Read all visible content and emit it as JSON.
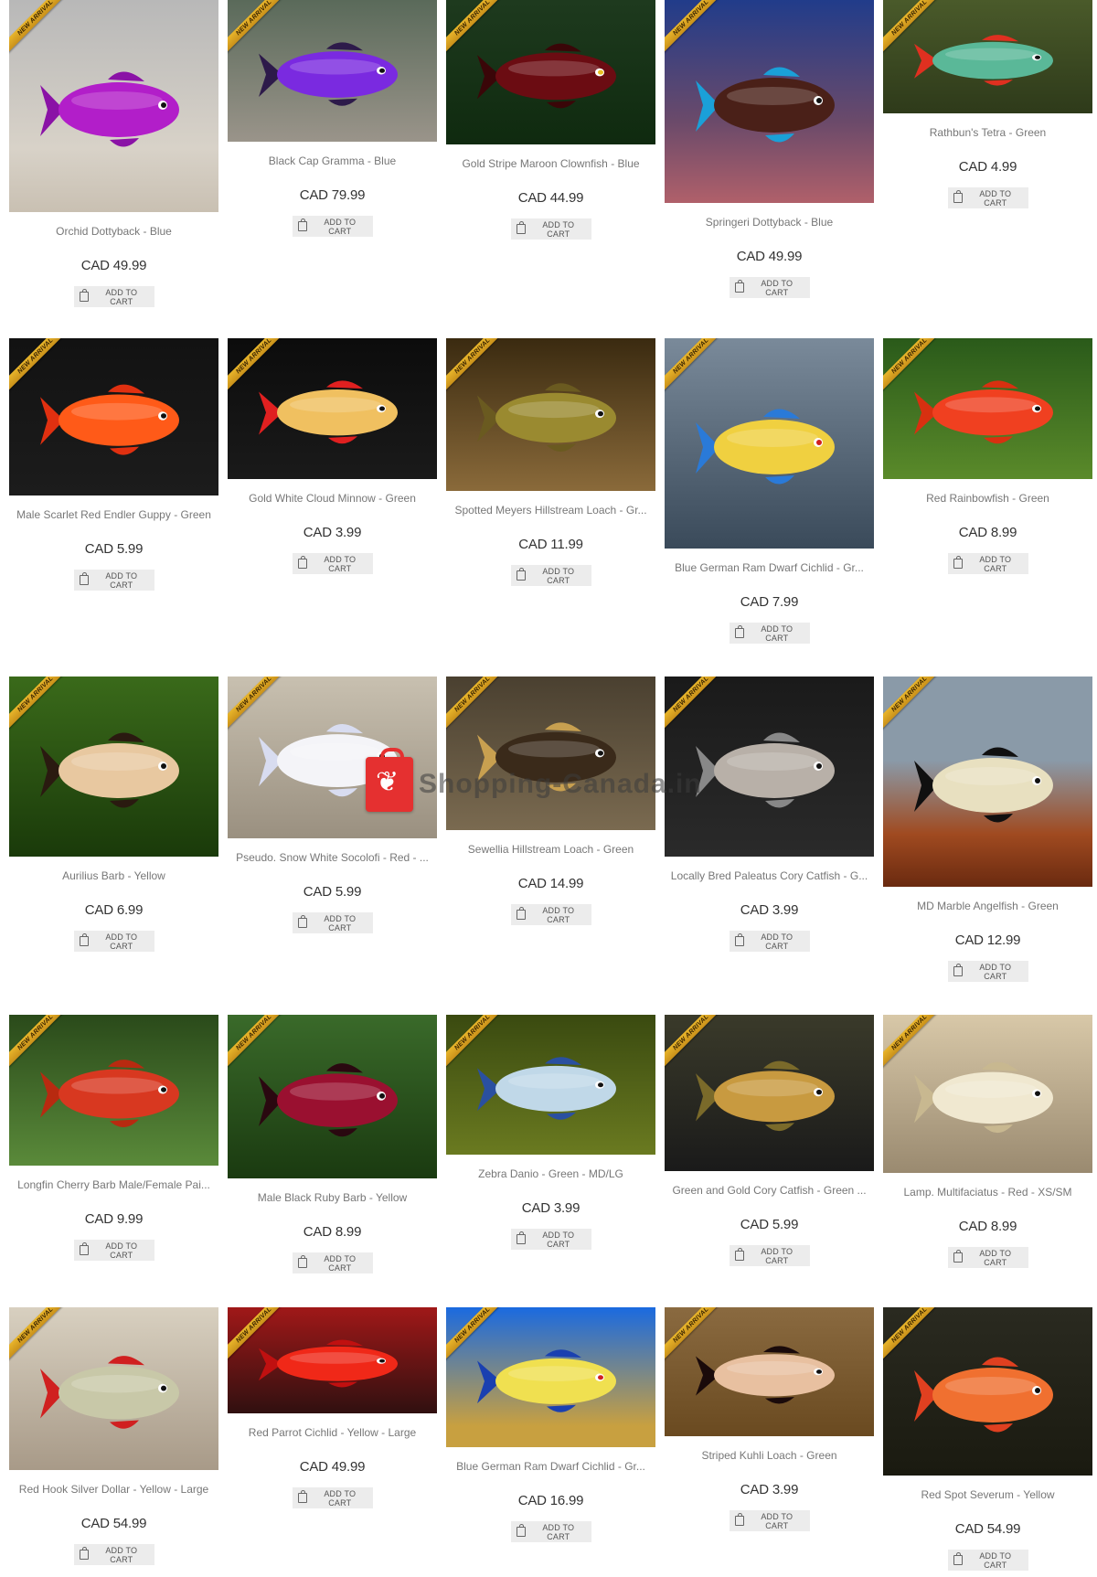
{
  "badge_text": "NEW ARRIVAL",
  "cart_label": "ADD TO CART",
  "watermark": "Shopping-Canada.in",
  "products": [
    {
      "title": "Orchid Dottyback - Blue",
      "price": "CAD 49.99"
    },
    {
      "title": "Black Cap Gramma - Blue",
      "price": "CAD 79.99"
    },
    {
      "title": "Gold Stripe Maroon Clownfish - Blue",
      "price": "CAD 44.99"
    },
    {
      "title": "Springeri Dottyback - Blue",
      "price": "CAD 49.99"
    },
    {
      "title": "Rathbun's Tetra - Green",
      "price": "CAD 4.99"
    },
    {
      "title": "Male Scarlet Red Endler Guppy - Green",
      "price": "CAD 5.99"
    },
    {
      "title": "Gold White Cloud Minnow - Green",
      "price": "CAD 3.99"
    },
    {
      "title": "Spotted Meyers Hillstream Loach - Gr...",
      "price": "CAD 11.99"
    },
    {
      "title": "Blue German Ram Dwarf Cichlid - Gr...",
      "price": "CAD 7.99"
    },
    {
      "title": "Red Rainbowfish - Green",
      "price": "CAD 8.99"
    },
    {
      "title": "Aurilius Barb - Yellow",
      "price": "CAD 6.99"
    },
    {
      "title": "Pseudo. Snow White Socolofi - Red - ...",
      "price": "CAD 5.99"
    },
    {
      "title": "Sewellia Hillstream Loach - Green",
      "price": "CAD 14.99"
    },
    {
      "title": "Locally Bred Paleatus Cory Catfish - G...",
      "price": "CAD 3.99"
    },
    {
      "title": "MD Marble Angelfish - Green",
      "price": "CAD 12.99"
    },
    {
      "title": "Longfin Cherry Barb Male/Female Pai...",
      "price": "CAD 9.99"
    },
    {
      "title": "Male Black Ruby Barb - Yellow",
      "price": "CAD 8.99"
    },
    {
      "title": "Zebra Danio - Green - MD/LG",
      "price": "CAD 3.99"
    },
    {
      "title": "Green and Gold Cory Catfish - Green ...",
      "price": "CAD 5.99"
    },
    {
      "title": "Lamp. Multifaciatus - Red - XS/SM",
      "price": "CAD 8.99"
    },
    {
      "title": "Red Hook Silver Dollar - Yellow - Large",
      "price": "CAD 54.99"
    },
    {
      "title": "Red Parrot Cichlid - Yellow - Large",
      "price": "CAD 49.99"
    },
    {
      "title": "Blue German Ram Dwarf Cichlid - Gr...",
      "price": "CAD 16.99"
    },
    {
      "title": "Striped Kuhli Loach - Green",
      "price": "CAD 3.99"
    },
    {
      "title": "Red Spot Severum - Yellow",
      "price": "CAD 54.99"
    }
  ]
}
